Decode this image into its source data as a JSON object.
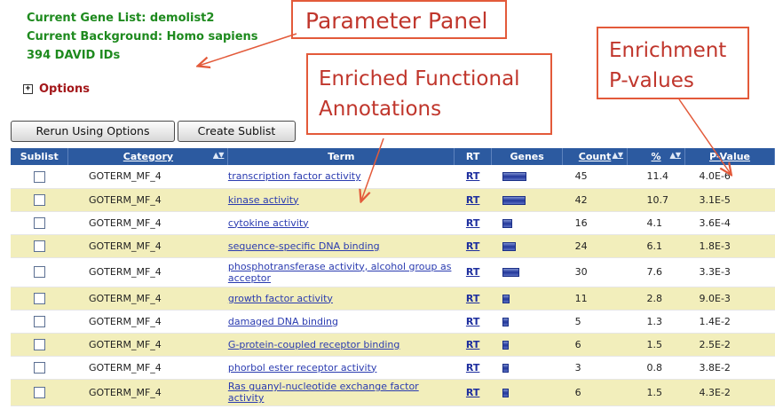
{
  "info": {
    "gene_list": "Current Gene List: demolist2",
    "background": "Current Background: Homo sapiens",
    "ids": "394 DAVID IDs"
  },
  "options": {
    "toggle_icon": "plus-box-icon",
    "label": "Options"
  },
  "buttons": {
    "rerun": "Rerun Using Options",
    "create_sublist": "Create Sublist"
  },
  "callouts": {
    "parameter_panel": "Parameter Panel",
    "enriched_line1": "Enriched Functional",
    "enriched_line2": "Annotations",
    "pvalues_line1": "Enrichment",
    "pvalues_line2": "P-values"
  },
  "colors": {
    "header_blue": "#2c5aa0",
    "row_yellow": "#f2eebb",
    "callout_red": "#e35a3a",
    "info_green": "#1e8a1e",
    "options_red": "#a3171a"
  },
  "table": {
    "headers": {
      "sublist": "Sublist",
      "category": "Category",
      "term": "Term",
      "rt": "RT",
      "genes": "Genes",
      "count": "Count",
      "pct": "%",
      "pvalue": "P-Value"
    },
    "rows": [
      {
        "category": "GOTERM_MF_4",
        "term": "transcription factor activity",
        "rt": "RT",
        "gene_bar": 0.9,
        "count": "45",
        "pct": "11.4",
        "pvalue": "4.0E-6"
      },
      {
        "category": "GOTERM_MF_4",
        "term": "kinase activity",
        "rt": "RT",
        "gene_bar": 0.84,
        "count": "42",
        "pct": "10.7",
        "pvalue": "3.1E-5"
      },
      {
        "category": "GOTERM_MF_4",
        "term": "cytokine activity",
        "rt": "RT",
        "gene_bar": 0.32,
        "count": "16",
        "pct": "4.1",
        "pvalue": "3.6E-4"
      },
      {
        "category": "GOTERM_MF_4",
        "term": "sequence-specific DNA binding",
        "rt": "RT",
        "gene_bar": 0.48,
        "count": "24",
        "pct": "6.1",
        "pvalue": "1.8E-3"
      },
      {
        "category": "GOTERM_MF_4",
        "term": "phosphotransferase activity, alcohol group as acceptor",
        "rt": "RT",
        "gene_bar": 0.6,
        "count": "30",
        "pct": "7.6",
        "pvalue": "3.3E-3"
      },
      {
        "category": "GOTERM_MF_4",
        "term": "growth factor activity",
        "rt": "RT",
        "gene_bar": 0.22,
        "count": "11",
        "pct": "2.8",
        "pvalue": "9.0E-3"
      },
      {
        "category": "GOTERM_MF_4",
        "term": "damaged DNA binding",
        "rt": "RT",
        "gene_bar": 0.1,
        "count": "5",
        "pct": "1.3",
        "pvalue": "1.4E-2"
      },
      {
        "category": "GOTERM_MF_4",
        "term": "G-protein-coupled receptor binding",
        "rt": "RT",
        "gene_bar": 0.12,
        "count": "6",
        "pct": "1.5",
        "pvalue": "2.5E-2"
      },
      {
        "category": "GOTERM_MF_4",
        "term": "phorbol ester receptor activity",
        "rt": "RT",
        "gene_bar": 0.06,
        "count": "3",
        "pct": "0.8",
        "pvalue": "3.8E-2"
      },
      {
        "category": "GOTERM_MF_4",
        "term": "Ras guanyl-nucleotide exchange factor activity",
        "rt": "RT",
        "gene_bar": 0.12,
        "count": "6",
        "pct": "1.5",
        "pvalue": "4.3E-2"
      }
    ]
  }
}
